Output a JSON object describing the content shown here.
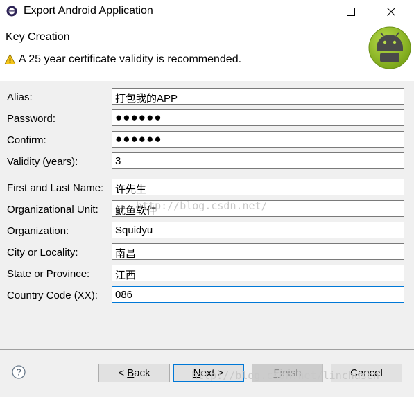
{
  "window": {
    "title": "Export Android Application",
    "minimize_icon": "minimize-icon",
    "maximize_icon": "maximize-icon",
    "close_icon": "close-icon"
  },
  "header": {
    "title": "Key Creation",
    "message": "A 25 year certificate validity is recommended.",
    "warning_icon": "warning-icon",
    "logo": "android-logo"
  },
  "form": {
    "alias": {
      "label": "Alias:",
      "value": "打包我的APP"
    },
    "password": {
      "label": "Password:",
      "value": "●●●●●●"
    },
    "confirm": {
      "label": "Confirm:",
      "value": "●●●●●●"
    },
    "validity": {
      "label": "Validity (years):",
      "value": "3"
    },
    "name": {
      "label": "First and Last Name:",
      "value": "许先生"
    },
    "org_unit": {
      "label": "Organizational Unit:",
      "value": "鱿鱼软件"
    },
    "organization": {
      "label": "Organization:",
      "value": "Squidyu"
    },
    "city": {
      "label": "City or Locality:",
      "value": "南昌"
    },
    "state": {
      "label": "State or Province:",
      "value": "江西"
    },
    "country": {
      "label": "Country Code (XX):",
      "value": "086"
    }
  },
  "footer": {
    "back_prefix": "< ",
    "back_key": "B",
    "back_rest": "ack",
    "next_key": "N",
    "next_rest": "ext >",
    "finish_key": "F",
    "finish_rest": "inish",
    "cancel": "Cancel",
    "help_icon": "help-icon"
  },
  "watermarks": {
    "middle": "http://blog.csdn.net/",
    "bottom": "http://blog.csdn.net/linchusen"
  },
  "colors": {
    "accent": "#0078d7",
    "panel": "#f0f0f0",
    "android_green": "#97c024"
  }
}
